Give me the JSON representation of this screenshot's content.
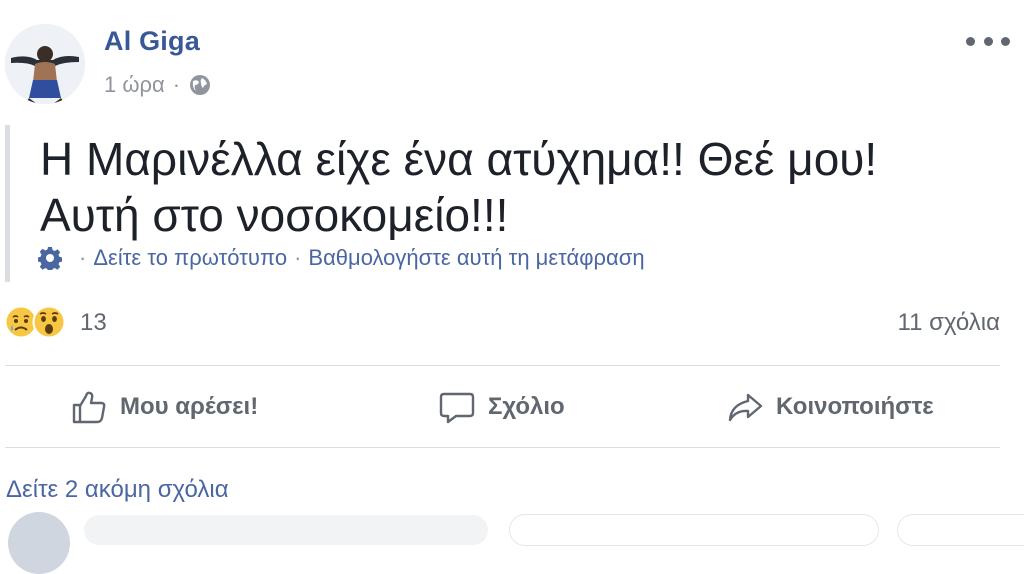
{
  "post": {
    "author": "Al Giga",
    "time": "1 ώρα",
    "meta_separator": "·",
    "text_line1": "Η Μαρινέλλα είχε ένα ατύχημα!! Θεέ μου!",
    "text_line2": "Αυτή στο νοσοκομείο!!!",
    "translation": {
      "see_original": "Δείτε το πρωτότυπο",
      "separator": "·",
      "rate_translation": "Βαθμολογήστε αυτή τη μετάφραση"
    }
  },
  "reactions": {
    "icons": [
      "sad-icon",
      "wow-icon"
    ],
    "count": "13",
    "comments_count": "11 σχόλια"
  },
  "actions": {
    "like": "Μου αρέσει!",
    "comment": "Σχόλιο",
    "share": "Κοινοποιήστε"
  },
  "comments": {
    "view_more": "Δείτε 2 ακόμη σχόλια"
  },
  "colors": {
    "link": "#4b67a1",
    "author": "#385898",
    "secondary_text": "#606770",
    "divider": "#dadde1"
  }
}
